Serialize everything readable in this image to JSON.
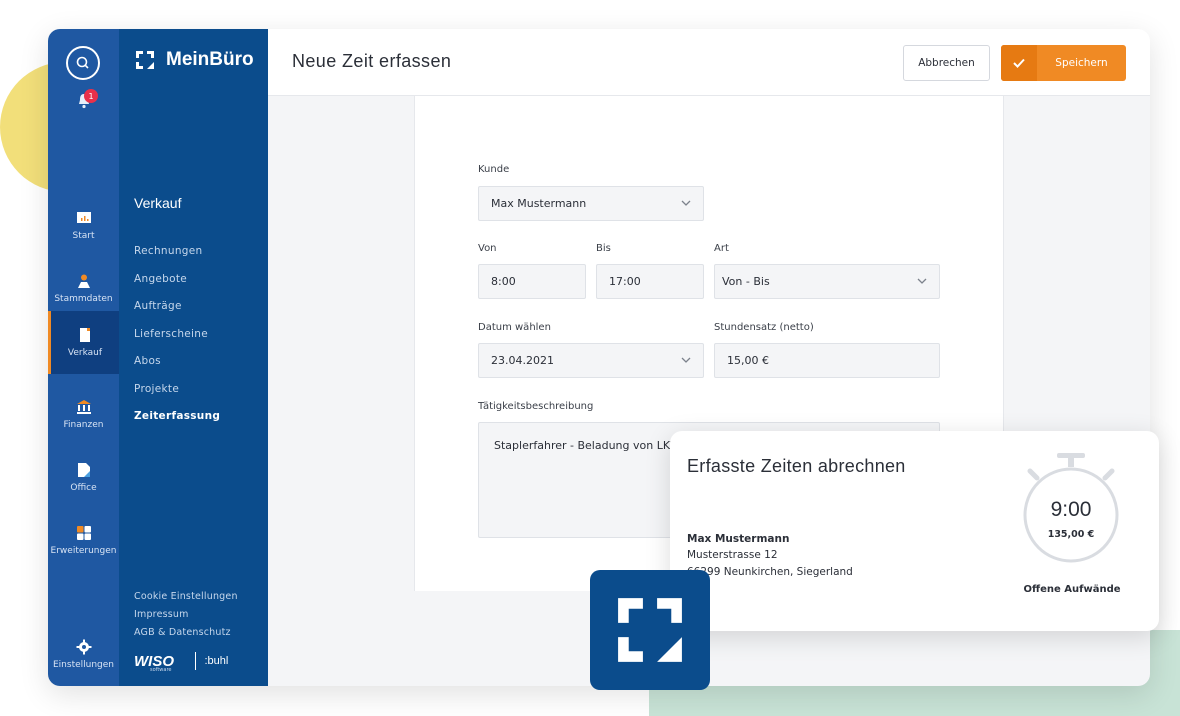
{
  "colors": {
    "rail": "#1f58a2",
    "nav": "#0b4c8c",
    "accent": "#f08a24",
    "badge": "#e8304a"
  },
  "rail": {
    "notifications_count": "1",
    "items": [
      {
        "label": "Start",
        "icon": "chart-icon"
      },
      {
        "label": "Stammdaten",
        "icon": "person-icon"
      },
      {
        "label": "Verkauf",
        "icon": "document-icon",
        "active": true
      },
      {
        "label": "Finanzen",
        "icon": "bank-icon"
      },
      {
        "label": "Office",
        "icon": "folder-icon"
      },
      {
        "label": "Erweiterungen",
        "icon": "grid-icon"
      },
      {
        "label": "Einstellungen",
        "icon": "gear-icon"
      }
    ]
  },
  "nav": {
    "brand": "MeinBüro",
    "section": "Verkauf",
    "items": [
      "Rechnungen",
      "Angebote",
      "Aufträge",
      "Lieferscheine",
      "Abos",
      "Projekte",
      "Zeiterfassung"
    ],
    "active_item": "Zeiterfassung",
    "footer": [
      "Cookie Einstellungen",
      "Impressum",
      "AGB & Datenschutz"
    ],
    "wiso": "WISO",
    "wiso_sub": "software",
    "buhl": ":buhl"
  },
  "header": {
    "title": "Neue Zeit erfassen",
    "cancel_label": "Abbrechen",
    "save_label": "Speichern"
  },
  "form": {
    "customer_label": "Kunde",
    "customer_value": "Max Mustermann",
    "from_label": "Von",
    "from_value": "8:00",
    "to_label": "Bis",
    "to_value": "17:00",
    "type_label": "Art",
    "type_value": "Von - Bis",
    "date_label": "Datum wählen",
    "date_value": "23.04.2021",
    "rate_label": "Stundensatz (netto)",
    "rate_value": "15,00 €",
    "description_label": "Tätigkeitsbeschreibung",
    "description_value": "Staplerfahrer - Beladung von LKWs"
  },
  "summary": {
    "title": "Erfasste Zeiten abrechnen",
    "name": "Max Mustermann",
    "street": "Musterstrasse 12",
    "city": "66299 Neunkirchen, Siegerland",
    "timer_value": "9:00",
    "timer_amount": "135,00 €",
    "caption": "Offene Aufwände"
  }
}
